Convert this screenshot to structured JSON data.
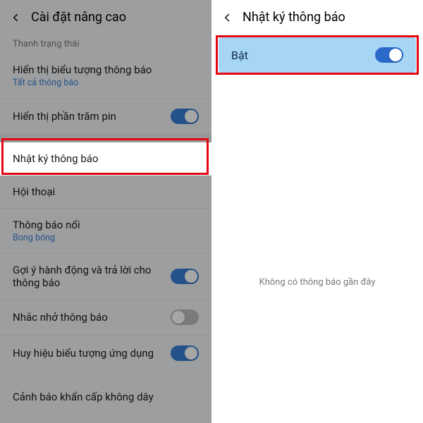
{
  "left": {
    "header_title": "Cài đặt nâng cao",
    "section_status": "Thanh trạng thái",
    "rows": {
      "show_icons": {
        "label": "Hiển thị biểu tượng thông báo",
        "sub": "Tất cả thông báo"
      },
      "show_battery": {
        "label": "Hiển thị phần trăm pin"
      },
      "notif_log": {
        "label": "Nhật ký thông báo"
      },
      "conversation": {
        "label": "Hội thoại"
      },
      "floating": {
        "label": "Thông báo nổi",
        "sub": "Bong bóng"
      },
      "suggest_actions": {
        "label": "Gợi ý hành động và trả lời cho thông báo"
      },
      "reminder": {
        "label": "Nhắc nhở thông báo"
      },
      "badge": {
        "label": "Huy hiệu biểu tượng ứng dụng"
      },
      "emergency": {
        "label": "Cảnh báo khẩn cấp không dây"
      }
    }
  },
  "right": {
    "header_title": "Nhật ký thông báo",
    "toggle_label": "Bật",
    "empty_message": "Không có thông báo gần đây"
  },
  "colors": {
    "accent": "#3a7fd5",
    "highlight": "#e30613",
    "right_row_bg": "#a7d6f5"
  }
}
